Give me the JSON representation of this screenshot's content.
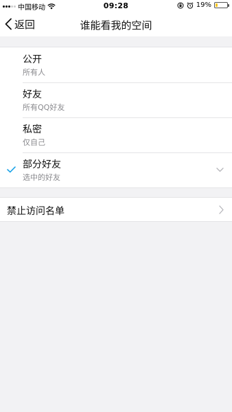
{
  "status_bar": {
    "carrier": "中国移动",
    "time": "09:28",
    "battery_percent": "19%",
    "battery_level": 0.19
  },
  "nav": {
    "back_label": "返回",
    "title": "谁能看我的空间"
  },
  "options": [
    {
      "title": "公开",
      "subtitle": "所有人",
      "selected": false
    },
    {
      "title": "好友",
      "subtitle": "所有QQ好友",
      "selected": false
    },
    {
      "title": "私密",
      "subtitle": "仅自己",
      "selected": false
    },
    {
      "title": "部分好友",
      "subtitle": "选中的好友",
      "selected": true,
      "expandable": true
    }
  ],
  "blacklist": {
    "label": "禁止访问名单"
  },
  "colors": {
    "accent": "#1aa3e8",
    "background": "#f2f2f4",
    "battery": "#f5c518"
  }
}
